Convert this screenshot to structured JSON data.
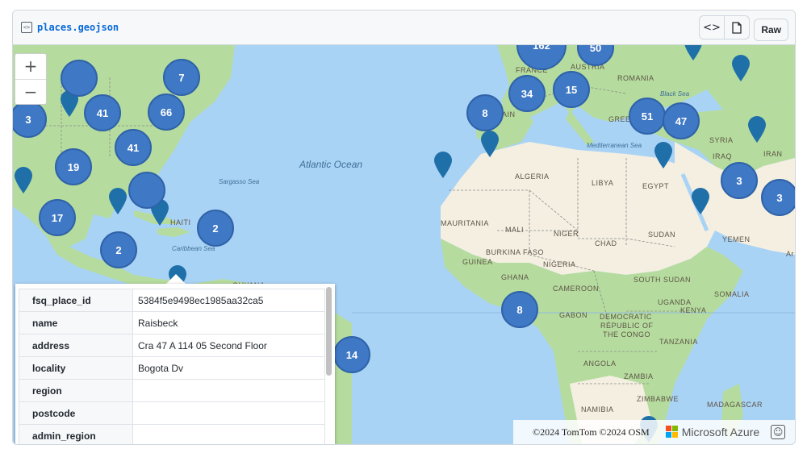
{
  "file": {
    "name": "places.geojson",
    "raw_label": "Raw",
    "code_icon": "code-icon",
    "file_icon": "file-icon"
  },
  "map": {
    "zoom_in": "+",
    "zoom_out": "−",
    "oceans": {
      "atlantic": "Atlantic Ocean",
      "sargasso": "Sargasso Sea",
      "caribbean": "Caribbean Sea",
      "mediterranean": "Mediterranean Sea",
      "black_sea": "Black Sea"
    },
    "countries": {
      "algeria": "ALGERIA",
      "libya": "LIBYA",
      "egypt": "EGYPT",
      "mauritania": "MAURITANIA",
      "mali": "MALI",
      "niger": "NIGER",
      "chad": "CHAD",
      "sudan": "SUDAN",
      "burkina": "BURKINA FASO",
      "nigeria": "NIGERIA",
      "ghana": "GHANA",
      "guinea": "GUINEA",
      "cameroon": "CAMEROON",
      "south_sudan": "SOUTH SUDAN",
      "uganda": "UGANDA",
      "kenya": "KENYA",
      "somalia": "SOMALIA",
      "gabon": "GABON",
      "drc1": "DEMOCRATIC",
      "drc2": "REPUBLIC OF",
      "drc3": "THE CONGO",
      "tanzania": "TANZANIA",
      "angola": "ANGOLA",
      "zambia": "ZAMBIA",
      "zimbabwe": "ZIMBABWE",
      "namibia": "NAMIBIA",
      "madagascar": "MADAGASCAR",
      "yemen": "YEMEN",
      "iraq": "IRAQ",
      "iran": "IRAN",
      "syria": "SYRIA",
      "haiti": "HAITI",
      "france": "FRANCE",
      "austria": "AUSTRIA",
      "romania": "ROMANIA",
      "greece": "GREE",
      "spain_frag": "AIN",
      "guyana": "GUYANA",
      "ar_frag": "Ar"
    },
    "clusters": [
      {
        "id": "c-top-left",
        "count": ""
      },
      {
        "id": "c-7",
        "count": "7"
      },
      {
        "id": "c-41a",
        "count": "41"
      },
      {
        "id": "c-66",
        "count": "66"
      },
      {
        "id": "c-3-west",
        "count": "3"
      },
      {
        "id": "c-41b",
        "count": "41"
      },
      {
        "id": "c-19",
        "count": "19"
      },
      {
        "id": "c-blank-gulf",
        "count": ""
      },
      {
        "id": "c-17",
        "count": "17"
      },
      {
        "id": "c-2a",
        "count": "2"
      },
      {
        "id": "c-2b",
        "count": "2"
      },
      {
        "id": "c-162",
        "count": "162"
      },
      {
        "id": "c-50",
        "count": "50"
      },
      {
        "id": "c-34",
        "count": "34"
      },
      {
        "id": "c-15",
        "count": "15"
      },
      {
        "id": "c-8-spain",
        "count": "8"
      },
      {
        "id": "c-51",
        "count": "51"
      },
      {
        "id": "c-47",
        "count": "47"
      },
      {
        "id": "c-3-mideast",
        "count": "3"
      },
      {
        "id": "c-3-gulf",
        "count": "3"
      },
      {
        "id": "c-8-africa",
        "count": "8"
      },
      {
        "id": "c-14",
        "count": "14"
      }
    ]
  },
  "popup": {
    "rows": [
      {
        "key": "fsq_place_id",
        "value": "5384f5e9498ec1985aa32ca5"
      },
      {
        "key": "name",
        "value": "Raisbeck"
      },
      {
        "key": "address",
        "value": "Cra 47 A 114 05 Second Floor"
      },
      {
        "key": "locality",
        "value": "Bogota Dv"
      },
      {
        "key": "region",
        "value": ""
      },
      {
        "key": "postcode",
        "value": ""
      },
      {
        "key": "admin_region",
        "value": ""
      }
    ]
  },
  "attribution": {
    "text": "©2024 TomTom ©2024 OSM",
    "brand": "Microsoft Azure",
    "colors": [
      "#f25022",
      "#7fba00",
      "#00a4ef",
      "#ffb900"
    ],
    "feedback_icon": "smiley-icon"
  },
  "colors": {
    "water": "#a9d3f5",
    "land_green": "#b5dc9e",
    "land_desert": "#f4efe1",
    "cluster": "#3f78c4",
    "pin": "#1f6fa8"
  }
}
